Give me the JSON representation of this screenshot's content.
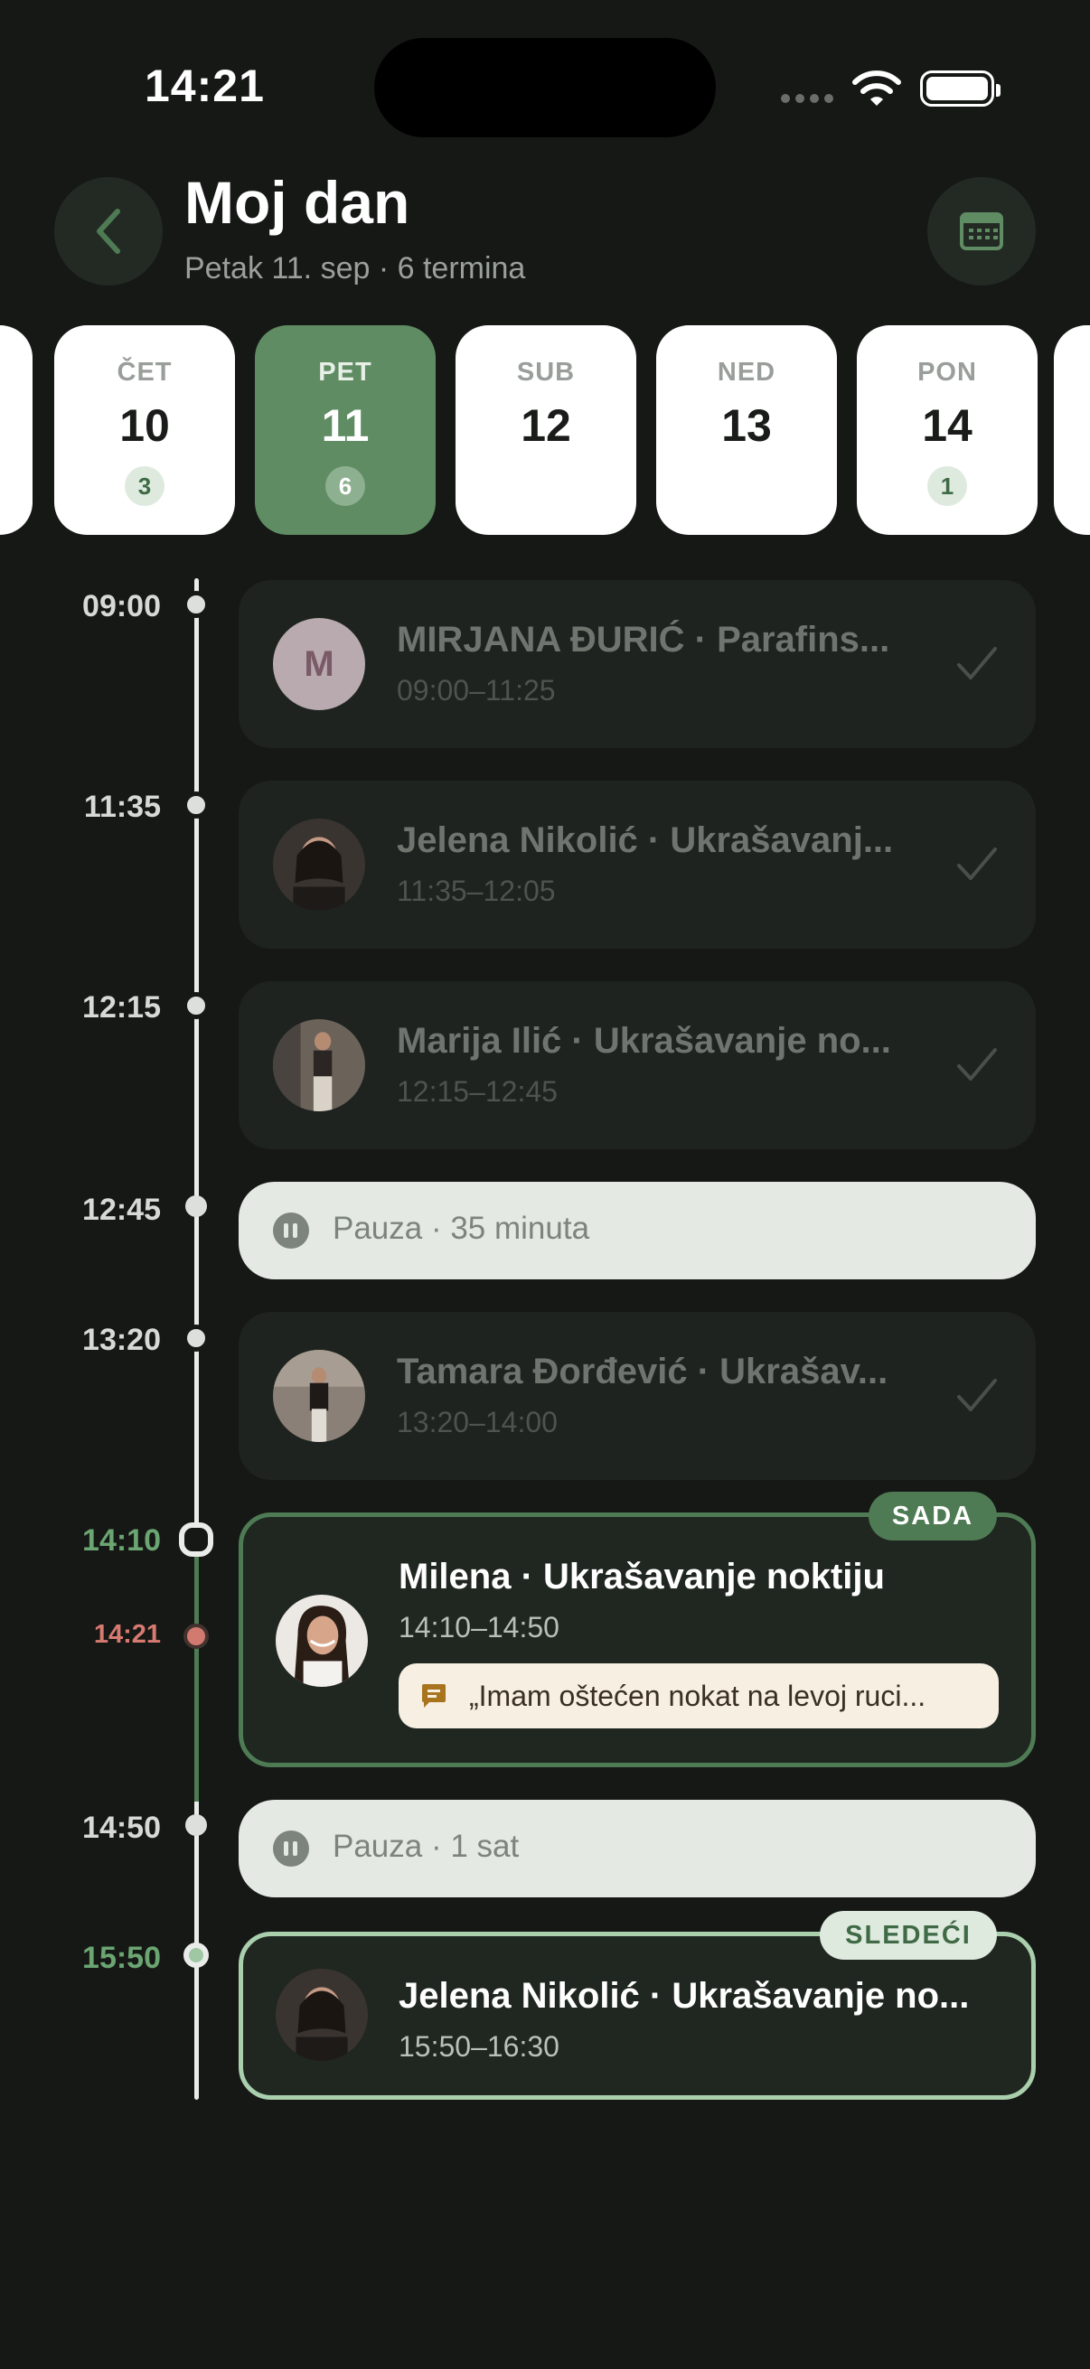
{
  "status_bar": {
    "time": "14:21"
  },
  "header": {
    "title": "Moj dan",
    "subtitle": "Petak 11. sep · 6 termina"
  },
  "days": [
    {
      "dow": "ČET",
      "num": "10",
      "count": "3",
      "selected": false
    },
    {
      "dow": "PET",
      "num": "11",
      "count": "6",
      "selected": true
    },
    {
      "dow": "SUB",
      "num": "12",
      "count": "",
      "selected": false
    },
    {
      "dow": "NED",
      "num": "13",
      "count": "",
      "selected": false
    },
    {
      "dow": "PON",
      "num": "14",
      "count": "1",
      "selected": false
    }
  ],
  "timeline": {
    "current_time": "14:21",
    "labels": [
      "09:00",
      "11:35",
      "12:15",
      "12:45",
      "13:20",
      "14:10",
      "14:50",
      "15:50"
    ]
  },
  "appointments": [
    {
      "initial": "M",
      "title": "MIRJANA ĐURIĆ · Parafins...",
      "time": "09:00–11:25"
    },
    {
      "title": "Jelena Nikolić · Ukrašavanj...",
      "time": "11:35–12:05"
    },
    {
      "title": "Marija Ilić · Ukrašavanje no...",
      "time": "12:15–12:45"
    },
    {
      "title": "Tamara Đorđević · Ukrašav...",
      "time": "13:20–14:00"
    }
  ],
  "breaks": [
    {
      "label": "Pauza · 35 minuta"
    },
    {
      "label": "Pauza · 1 sat"
    }
  ],
  "current": {
    "badge": "SADA",
    "title": "Milena · Ukrašavanje noktiju",
    "time": "14:10–14:50",
    "note": "„Imam oštećen nokat na levoj ruci..."
  },
  "next": {
    "badge": "SLEDEĆI",
    "title": "Jelena Nikolić · Ukrašavanje no...",
    "time": "15:50–16:30"
  },
  "colors": {
    "background": "#161816",
    "accent": "#5f8c63",
    "now_time": "#d77a70"
  }
}
